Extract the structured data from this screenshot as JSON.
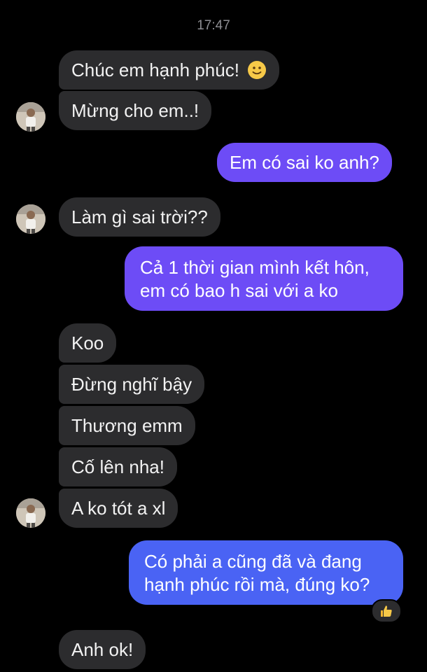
{
  "header": {
    "time": "17:47"
  },
  "messages": [
    {
      "text": "Chúc em hạnh phúc!",
      "emoji": "slightly-smiling-face-icon"
    },
    {
      "text": "Mừng cho em..!"
    },
    {
      "text": "Em có sai ko anh?"
    },
    {
      "text": "Làm gì sai trời??"
    },
    {
      "line1": "Cả 1 thời gian mình kết hôn,",
      "line2": "em có bao h sai với a ko"
    },
    {
      "text": "Koo"
    },
    {
      "text": "Đừng nghĩ bậy"
    },
    {
      "text": "Thương emm"
    },
    {
      "text": "Cố lên nha!"
    },
    {
      "text": "A ko tót a xl"
    },
    {
      "line1": "Có phải a cũng đã và đang",
      "line2": "hạnh phúc rồi mà, đúng ko?",
      "reaction": "thumbs-up-icon"
    },
    {
      "text": "Anh ok!"
    }
  ],
  "colors": {
    "background": "#000000",
    "incoming_bubble": "#2c2c2e",
    "outgoing_purple": "#6d4cf6",
    "outgoing_blue": "#4a63f4"
  }
}
